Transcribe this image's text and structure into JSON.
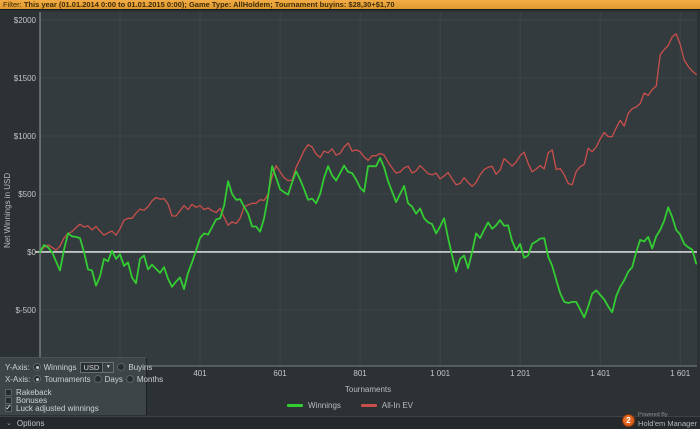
{
  "filter_bar": {
    "label": "Filter:",
    "value": "This year (01.01.2014 0:00 to 01.01.2015 0:00); Game Type: AllHoldem; Tournament buyins: $28,30+$1,70"
  },
  "icons": {
    "dropdown_arrow": "▼",
    "check": "✓",
    "chevron_down": "⌄"
  },
  "controls": {
    "y_axis": {
      "label": "Y-Axis:",
      "options": [
        {
          "label": "Winnings",
          "selected": true
        },
        {
          "label": "Buyins",
          "selected": false
        }
      ],
      "currency_dropdown": {
        "value": "USD"
      }
    },
    "x_axis": {
      "label": "X-Axis:",
      "options": [
        {
          "label": "Tournaments",
          "selected": true
        },
        {
          "label": "Days",
          "selected": false
        },
        {
          "label": "Months",
          "selected": false
        }
      ]
    },
    "checkboxes": [
      {
        "label": "Rakeback",
        "checked": false
      },
      {
        "label": "Bonuses",
        "checked": false
      },
      {
        "label": "Luck adjusted winnings",
        "checked": true
      }
    ]
  },
  "options_bar": {
    "label": "Options"
  },
  "branding": {
    "powered_by": "Powered By",
    "app_name": "Hold'em Manager",
    "logo_text": "2"
  },
  "chart_data": {
    "type": "line",
    "title": "",
    "xlabel": "Tournaments",
    "ylabel": "Net Winnings in USD",
    "xlim": [
      1,
      1643
    ],
    "ylim": [
      -983,
      2069
    ],
    "x_tick_values": [
      401,
      601,
      801,
      1001,
      1201,
      1401,
      1601
    ],
    "x_tick_labels": [
      "401",
      "601",
      "801",
      "1 001",
      "1 201",
      "1 401",
      "1 601"
    ],
    "x_grid_values": [
      1,
      201,
      401,
      601,
      801,
      1001,
      1201,
      1401,
      1601
    ],
    "y_tick_values": [
      2000,
      1500,
      1000,
      500,
      0,
      -500
    ],
    "y_tick_labels": [
      "$2000",
      "$1500",
      "$1000",
      "$500",
      "$0",
      "$-500"
    ],
    "grid": true,
    "grid_color": "#3e464a",
    "plot_bg": "#343b3e",
    "zero_line_color": "#f2f2f2",
    "axis_color": "#9aa0a3",
    "legend_position": "bottom",
    "t_start": 1,
    "t_step": 10,
    "series": [
      {
        "name": "Winnings",
        "color": "#33cc33",
        "values": [
          0,
          60,
          40,
          0,
          -80,
          -160,
          20,
          160,
          135,
          130,
          120,
          0,
          -150,
          -160,
          -290,
          -210,
          -60,
          -80,
          10,
          -60,
          -20,
          -120,
          -90,
          -220,
          -270,
          -60,
          -30,
          -150,
          -110,
          -145,
          -180,
          -130,
          -230,
          -300,
          -255,
          -220,
          -320,
          -180,
          -90,
          10,
          120,
          160,
          150,
          215,
          280,
          290,
          400,
          610,
          500,
          450,
          455,
          390,
          330,
          220,
          220,
          175,
          290,
          480,
          740,
          640,
          540,
          515,
          495,
          600,
          695,
          625,
          540,
          450,
          460,
          420,
          500,
          640,
          740,
          660,
          615,
          680,
          745,
          690,
          680,
          625,
          555,
          520,
          740,
          740,
          740,
          810,
          730,
          610,
          520,
          430,
          500,
          570,
          420,
          390,
          330,
          375,
          290,
          255,
          240,
          160,
          220,
          290,
          120,
          -30,
          -170,
          -60,
          -30,
          -140,
          0,
          160,
          120,
          190,
          255,
          200,
          230,
          275,
          225,
          230,
          95,
          15,
          70,
          -50,
          -30,
          70,
          90,
          115,
          120,
          -40,
          -120,
          -240,
          -355,
          -430,
          -440,
          -430,
          -430,
          -495,
          -565,
          -470,
          -360,
          -330,
          -370,
          -410,
          -470,
          -520,
          -380,
          -300,
          -245,
          -170,
          -130,
          0,
          105,
          90,
          130,
          30,
          135,
          190,
          270,
          385,
          300,
          190,
          150,
          70,
          40,
          20,
          -100
        ]
      },
      {
        "name": "All-In EV",
        "color": "#c94f4b",
        "values": [
          0,
          40,
          60,
          40,
          15,
          50,
          120,
          160,
          175,
          210,
          240,
          215,
          225,
          190,
          220,
          180,
          145,
          165,
          180,
          145,
          200,
          275,
          290,
          290,
          335,
          370,
          360,
          390,
          440,
          470,
          455,
          460,
          415,
          310,
          310,
          355,
          400,
          365,
          410,
          385,
          400,
          365,
          380,
          355,
          340,
          375,
          300,
          230,
          260,
          245,
          290,
          390,
          405,
          420,
          420,
          450,
          445,
          500,
          650,
          745,
          690,
          640,
          615,
          620,
          730,
          800,
          875,
          925,
          905,
          845,
          815,
          870,
          855,
          890,
          835,
          850,
          905,
          940,
          870,
          880,
          865,
          820,
          790,
          830,
          830,
          850,
          835,
          775,
          725,
          680,
          690,
          725,
          740,
          680,
          700,
          745,
          710,
          675,
          665,
          680,
          630,
          655,
          685,
          630,
          580,
          590,
          640,
          600,
          565,
          600,
          665,
          710,
          730,
          740,
          670,
          705,
          805,
          775,
          740,
          775,
          830,
          860,
          765,
          690,
          715,
          745,
          715,
          855,
          880,
          710,
          720,
          665,
          590,
          580,
          695,
          735,
          755,
          895,
          865,
          905,
          975,
          1030,
          995,
          995,
          1070,
          1135,
          1085,
          1195,
          1235,
          1250,
          1280,
          1370,
          1350,
          1400,
          1430,
          1700,
          1745,
          1780,
          1855,
          1880,
          1790,
          1655,
          1600,
          1560,
          1530
        ]
      }
    ]
  }
}
